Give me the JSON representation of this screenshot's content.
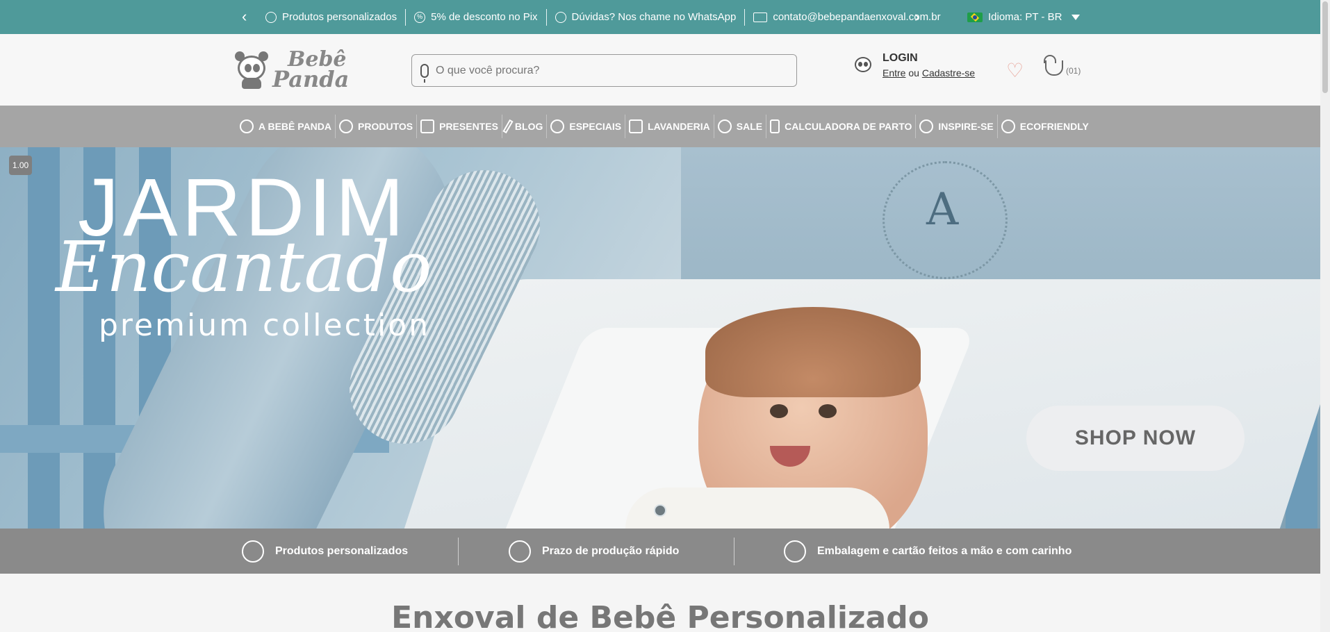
{
  "topbar": {
    "items": [
      {
        "label": "Produtos personalizados",
        "icon": "palette-icon"
      },
      {
        "label": "5% de desconto no Pix",
        "icon": "percent-icon"
      },
      {
        "label": "Dúvidas? Nos chame no WhatsApp",
        "icon": "whatsapp-icon"
      },
      {
        "label": "contato@bebepandaenxoval.com.br",
        "icon": "mail-icon"
      }
    ],
    "prev": "‹",
    "next": "›",
    "language": "Idioma: PT - BR",
    "bg_color": "#4f9a9a"
  },
  "header": {
    "logo_line1": "Bebê",
    "logo_line2": "Panda",
    "search_placeholder": "O que você procura?",
    "login_title": "LOGIN",
    "login_entre": "Entre",
    "login_ou": "ou",
    "login_cadastre": "Cadastre-se",
    "wishlist_icon": "♡",
    "cart_count": "(01)"
  },
  "nav": {
    "items": [
      {
        "label": "A BEBÊ PANDA",
        "icon": "panda-icon"
      },
      {
        "label": "PRODUTOS",
        "icon": "mobile-toy-icon"
      },
      {
        "label": "PRESENTES",
        "icon": "gift-icon"
      },
      {
        "label": "BLOG",
        "icon": "pencil-icon"
      },
      {
        "label": "ESPECIAIS",
        "icon": "special-icon"
      },
      {
        "label": "LAVANDERIA",
        "icon": "laundry-icon"
      },
      {
        "label": "SALE",
        "icon": "sale-icon"
      },
      {
        "label": "CALCULADORA DE PARTO",
        "icon": "calculator-icon"
      },
      {
        "label": "INSPIRE-SE",
        "icon": "stars-icon"
      },
      {
        "label": "ECOFRIENDLY",
        "icon": "leaf-hand-icon"
      }
    ],
    "bg_color": "#a5a5a5"
  },
  "hero": {
    "zoom": "1.00",
    "title_line1": "JARDIM",
    "title_line2": "Encantado",
    "title_line3": "premium collection",
    "monogram": "A",
    "cta": "SHOP NOW",
    "slide_count": 1
  },
  "benefits": {
    "items": [
      {
        "label": "Produtos personalizados",
        "icon": "palette-icon"
      },
      {
        "label": "Prazo de produção rápido",
        "icon": "fast-timer-icon"
      },
      {
        "label": "Embalagem e cartão feitos a mão e com carinho",
        "icon": "heart-hand-icon"
      }
    ],
    "bg_color": "#8a8a8a"
  },
  "section": {
    "title": "Enxoval de Bebê Personalizado"
  }
}
